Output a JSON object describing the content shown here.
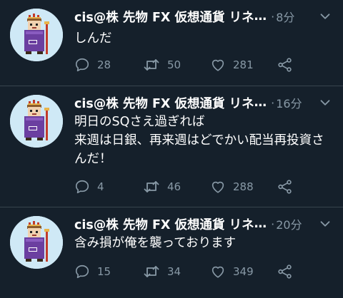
{
  "tweets": [
    {
      "author": "cis@株 先物 FX 仮想通貨 リネ",
      "ellipsis": "…",
      "separator": "·",
      "time": "8分",
      "text": "しんだ",
      "replies": "28",
      "retweets": "50",
      "likes": "281"
    },
    {
      "author": "cis@株 先物 FX 仮想通貨 リネ",
      "ellipsis": "…",
      "separator": "·",
      "time": "16分",
      "text": "明日のSQさえ過ぎれば\n来週は日銀、再来週はどでかい配当再投資さんだ！",
      "replies": "4",
      "retweets": "46",
      "likes": "288"
    },
    {
      "author": "cis@株 先物 FX 仮想通貨 リネ",
      "ellipsis": "…",
      "separator": "·",
      "time": "20分",
      "text": "含み損が俺を襲っております",
      "replies": "15",
      "retweets": "34",
      "likes": "349"
    }
  ],
  "colors": {
    "background": "#15202b",
    "text": "#ffffff",
    "muted": "#8899a6",
    "divider": "#38444d",
    "avatar_bg": "#cfe9f6"
  },
  "icons": [
    "chevron-down-icon",
    "reply-icon",
    "retweet-icon",
    "like-icon",
    "share-icon"
  ]
}
